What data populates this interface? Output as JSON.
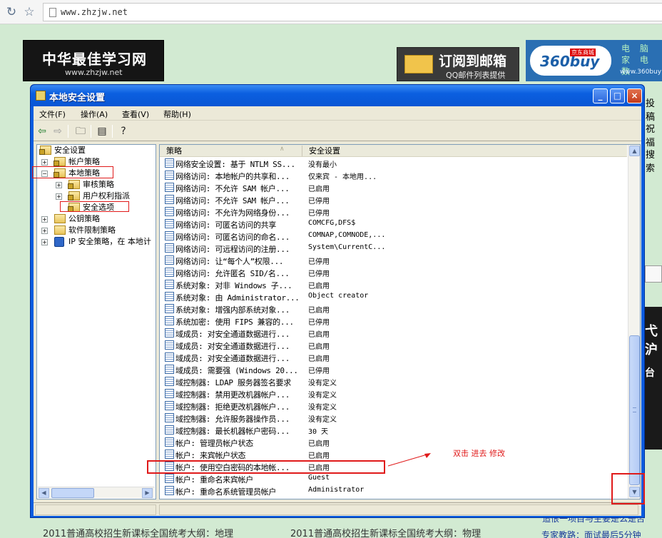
{
  "browser": {
    "url": "www.zhzjw.net"
  },
  "page": {
    "logo_main": "中华最佳学习网",
    "logo_sub": "www.zhzjw.net",
    "subscribe_title": "订阅到邮箱",
    "subscribe_sub": "QQ邮件列表提供",
    "ad_logo": "360buy",
    "ad_tag": "京东商城",
    "ad_words": "电 脑 家 电 数",
    "ad_url": "www.360buy",
    "side_words": [
      "投稿",
      "祝福",
      "搜索"
    ],
    "side_img_text_1": "弋沪",
    "side_img_text_2": "台",
    "bottom_left": "2011普通高校招生新课标全国统考大纲：地理",
    "bottom_mid": "2011普通高校招生新课标全国统考大纲：物理",
    "bottom_right_1": "专家教路：面试最后5分钟",
    "bottom_right_2": "追恨一项目与主要是么是否"
  },
  "window": {
    "title": "本地安全设置",
    "menus": [
      "文件(F)",
      "操作(A)",
      "查看(V)",
      "帮助(H)"
    ],
    "tree": [
      {
        "label": "安全设置"
      },
      {
        "label": "帐户策略"
      },
      {
        "label": "本地策略"
      },
      {
        "label": "审核策略"
      },
      {
        "label": "用户权利指派"
      },
      {
        "label": "安全选项"
      },
      {
        "label": "公钥策略"
      },
      {
        "label": "软件限制策略"
      },
      {
        "label": "IP 安全策略，在 本地计"
      }
    ],
    "columns": {
      "policy": "策略",
      "setting": "安全设置"
    },
    "rows": [
      {
        "name": "网络安全设置: 基于 NTLM SS...",
        "value": "没有最小"
      },
      {
        "name": "网络访问: 本地帐户的共享和...",
        "value": "仅来宾 - 本地用..."
      },
      {
        "name": "网络访问: 不允许 SAM 帐户...",
        "value": "已启用"
      },
      {
        "name": "网络访问: 不允许 SAM 帐户...",
        "value": "已停用"
      },
      {
        "name": "网络访问: 不允许为网络身份...",
        "value": "已停用"
      },
      {
        "name": "网络访问: 可匿名访问的共享",
        "value": "COMCFG,DFS$"
      },
      {
        "name": "网络访问: 可匿名访问的命名...",
        "value": "COMNAP,COMNODE,..."
      },
      {
        "name": "网络访问: 可远程访问的注册...",
        "value": "System\\CurrentC..."
      },
      {
        "name": "网络访问: 让“每个人”权限...",
        "value": "已停用"
      },
      {
        "name": "网络访问: 允许匿名 SID/名...",
        "value": "已停用"
      },
      {
        "name": "系统对象: 对非 Windows 子...",
        "value": "已启用"
      },
      {
        "name": "系统对象: 由 Administrator...",
        "value": "Object creator"
      },
      {
        "name": "系统对象: 增强内部系统对象...",
        "value": "已启用"
      },
      {
        "name": "系统加密: 使用 FIPS 兼容的...",
        "value": "已停用"
      },
      {
        "name": "域成员: 对安全通道数据进行...",
        "value": "已启用"
      },
      {
        "name": "域成员: 对安全通道数据进行...",
        "value": "已启用"
      },
      {
        "name": "域成员: 对安全通道数据进行...",
        "value": "已启用"
      },
      {
        "name": "域成员: 需要强 (Windows 20...",
        "value": "已停用"
      },
      {
        "name": "域控制器: LDAP 服务器签名要求",
        "value": "没有定义"
      },
      {
        "name": "域控制器: 禁用更改机器帐户...",
        "value": "没有定义"
      },
      {
        "name": "域控制器: 拒绝更改机器帐户...",
        "value": "没有定义"
      },
      {
        "name": "域控制器: 允许服务器操作员...",
        "value": "没有定义"
      },
      {
        "name": "域控制器: 最长机器帐户密码...",
        "value": "30 天"
      },
      {
        "name": "帐户: 管理员帐户状态",
        "value": "已启用"
      },
      {
        "name": "帐户: 来宾帐户状态",
        "value": "已启用"
      },
      {
        "name": "帐户: 使用空白密码的本地帐...",
        "value": "已启用"
      },
      {
        "name": "帐户: 重命名来宾帐户",
        "value": "Guest"
      },
      {
        "name": "帐户: 重命名系统管理员帐户",
        "value": "Administrator"
      }
    ]
  },
  "annotation": {
    "text": "双击 进去 修改",
    "color": "#e01a1a"
  }
}
